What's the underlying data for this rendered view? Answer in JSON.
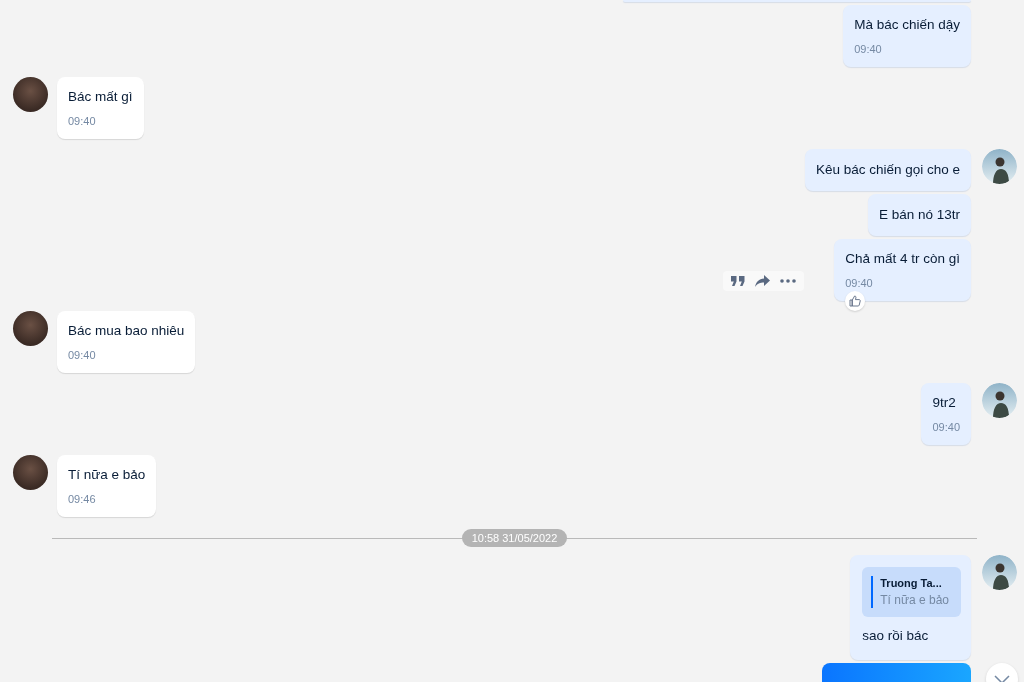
{
  "messages": [
    {
      "kind": "sent_clipped"
    },
    {
      "kind": "sent",
      "avatar": false,
      "text": "Mà bác chiến dậy",
      "time": "09:40",
      "actions_shown": false,
      "reacted": false
    },
    {
      "kind": "received",
      "avatar": true,
      "text": "Bác mất gì",
      "time": "09:40",
      "actions_shown": false,
      "reacted": false
    },
    {
      "kind": "sent",
      "avatar": true,
      "text": "Kêu bác chiến gọi cho e",
      "actions_shown": false,
      "reacted": false
    },
    {
      "kind": "sent",
      "avatar": false,
      "text": "E bán nó 13tr",
      "actions_shown": false,
      "reacted": false
    },
    {
      "kind": "sent",
      "avatar": false,
      "text": "Chả mất 4 tr còn gì",
      "time": "09:40",
      "actions_shown": true,
      "reacted": true
    },
    {
      "kind": "received",
      "avatar": true,
      "text": "Bác mua bao nhiêu",
      "time": "09:40",
      "actions_shown": false,
      "reacted": false
    },
    {
      "kind": "sent",
      "avatar": true,
      "text": "9tr2",
      "time": "09:40",
      "actions_shown": false,
      "reacted": false
    },
    {
      "kind": "received",
      "avatar": true,
      "text": "Tí nữa e bảo",
      "time": "09:46",
      "actions_shown": false,
      "reacted": false
    },
    {
      "kind": "divider",
      "label": "10:58 31/05/2022"
    },
    {
      "kind": "sent",
      "avatar": true,
      "quote": {
        "author": "Truong Ta...",
        "text": "Tí nữa e bảo"
      },
      "text": "sao rồi bác",
      "actions_shown": false,
      "reacted": false
    },
    {
      "kind": "sent_image"
    }
  ],
  "scroll_down_button": true
}
